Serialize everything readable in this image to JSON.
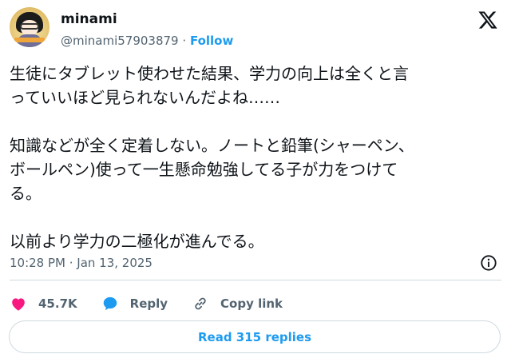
{
  "author": {
    "name": "minami",
    "handle": "@minami57903879",
    "separator": "·",
    "follow_label": "Follow"
  },
  "tweet": {
    "text": "生徒にタブレット使わせた結果、学力の向上は全くと言\nっていいほど見られないんだよね……\n\n知識などが全く定着しない。ノートと鉛筆(シャーペン、\nボールペン)使って一生懸命勉強してる子が力をつけて\nる。\n\n以前より学力の二極化が進んでる。",
    "timestamp": "10:28 PM · Jan 13, 2025"
  },
  "actions": {
    "likes_count": "45.7K",
    "reply_label": "Reply",
    "copy_link_label": "Copy link"
  },
  "read_replies_label": "Read 315 replies",
  "colors": {
    "accent": "#1d9bf0",
    "like": "#f91880",
    "muted": "#536471",
    "border": "#cfd9de"
  },
  "icons": [
    "avatar-image",
    "x-logo-icon",
    "info-icon",
    "heart-icon",
    "reply-bubble-icon",
    "link-icon"
  ]
}
